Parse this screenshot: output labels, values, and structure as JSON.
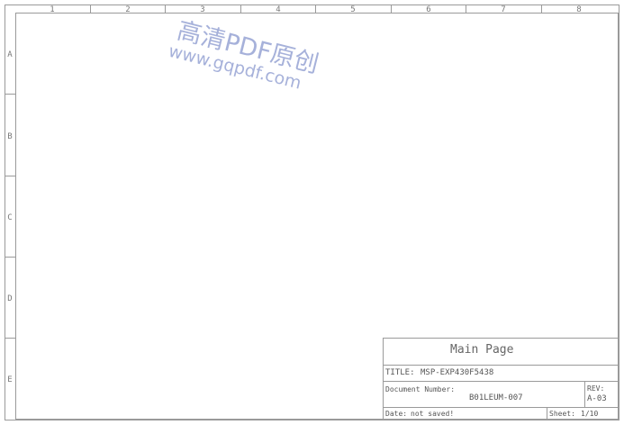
{
  "frame": {
    "column_labels": [
      "1",
      "2",
      "3",
      "4",
      "5",
      "6",
      "7",
      "8"
    ],
    "row_labels": [
      "A",
      "B",
      "C",
      "D",
      "E"
    ]
  },
  "title_block": {
    "heading": "Main Page",
    "title_label": "TITLE:",
    "title_value": "MSP-EXP430F5438",
    "document_number_label": "Document Number:",
    "document_number_value": "B01LEUM-007",
    "rev_label": "REV:",
    "rev_value": "A-03",
    "date_label": "Date:",
    "date_value": "not saved!",
    "sheet_label": "Sheet:",
    "sheet_value": "1/10"
  },
  "watermark": {
    "line1": "高清PDF原创",
    "line2": "www.gqpdf.com"
  },
  "colors": {
    "frame_line": "#9a9a9a",
    "text": "#555555",
    "watermark": "#9da9d6"
  }
}
